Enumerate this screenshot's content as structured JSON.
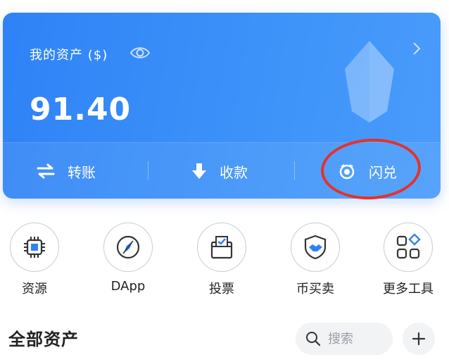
{
  "asset_card": {
    "label": "我的资产 ($)",
    "balance": "91.40",
    "actions": [
      {
        "label": "转账",
        "icon": "transfer-icon"
      },
      {
        "label": "收款",
        "icon": "download-icon"
      },
      {
        "label": "闪兑",
        "icon": "swap-icon"
      }
    ]
  },
  "tools": [
    {
      "label": "资源",
      "icon": "chip-icon"
    },
    {
      "label": "DApp",
      "icon": "compass-icon"
    },
    {
      "label": "投票",
      "icon": "ballot-box-icon"
    },
    {
      "label": "币买卖",
      "icon": "handshake-shield-icon"
    },
    {
      "label": "更多工具",
      "icon": "grid-icon"
    }
  ],
  "assets_section": {
    "title": "全部资产",
    "search_placeholder": "搜索"
  },
  "colors": {
    "card_gradient_start": "#2f82f6",
    "card_gradient_end": "#4a9cfb",
    "annotation_circle": "#e5322a"
  }
}
